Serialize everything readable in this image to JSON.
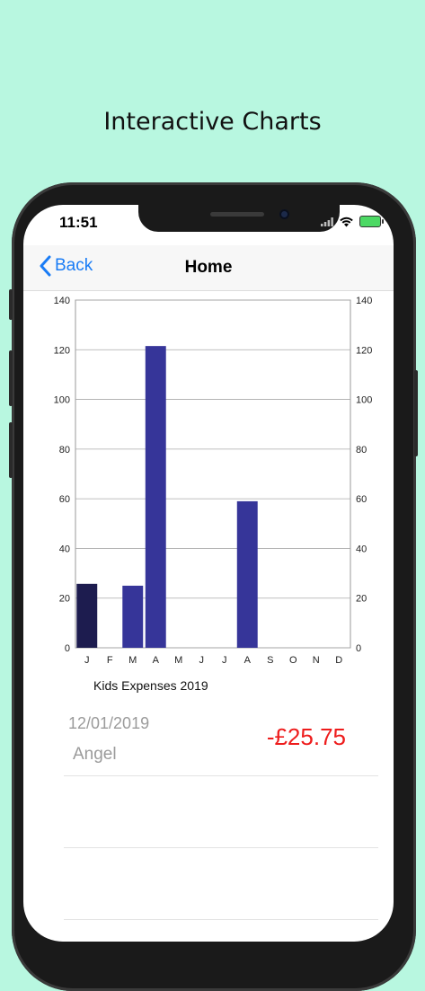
{
  "promo": {
    "title": "Interactive Charts"
  },
  "status_bar": {
    "time": "11:51"
  },
  "nav": {
    "back_label": "Back",
    "title": "Home"
  },
  "chart_data": {
    "type": "bar",
    "categories": [
      "J",
      "F",
      "M",
      "A",
      "M",
      "J",
      "J",
      "A",
      "S",
      "O",
      "N",
      "D"
    ],
    "values": [
      25.75,
      0,
      25,
      121.5,
      0,
      0,
      0,
      59,
      0,
      0,
      0,
      0
    ],
    "ylim": [
      0,
      140
    ],
    "yticks": [
      0,
      20,
      40,
      60,
      80,
      100,
      120,
      140
    ],
    "caption": "Kids Expenses 2019",
    "selected_index": 0,
    "bar_color": "#363599",
    "selected_color": "#1d1c4f",
    "grid": true
  },
  "transactions": [
    {
      "date": "12/01/2019",
      "name": "Angel",
      "amount": "-£25.75"
    },
    {
      "date": "",
      "name": "",
      "amount": ""
    },
    {
      "date": "",
      "name": "",
      "amount": ""
    }
  ]
}
